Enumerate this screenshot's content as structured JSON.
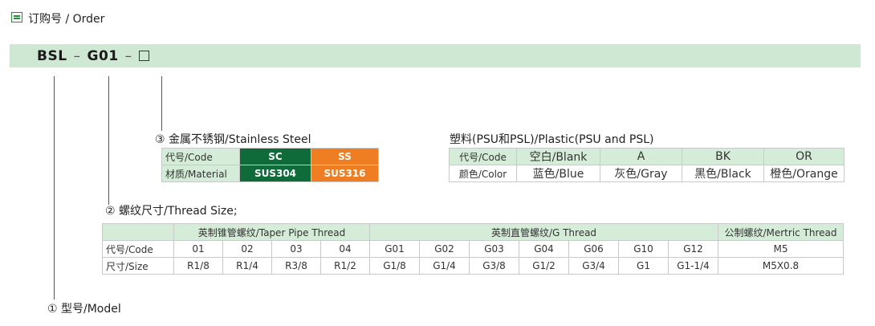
{
  "header": {
    "title": "订购号 / Order"
  },
  "code": {
    "part1": "BSL",
    "sep": "–",
    "part2": "G01"
  },
  "labels": {
    "material": "③ 金属不锈钢/Stainless Steel",
    "plastic": "塑料(PSU和PSL)/Plastic(PSU and PSL)",
    "thread": "② 螺纹尺寸/Thread Size;",
    "model": "① 型号/Model"
  },
  "material_table": {
    "row1": [
      "代号/Code",
      "SC",
      "SS"
    ],
    "row2": [
      "材质/Material",
      "SUS304",
      "SUS316"
    ]
  },
  "plastic_table": {
    "row1": [
      "代号/Code",
      "空白/Blank",
      "A",
      "BK",
      "OR"
    ],
    "row2": [
      "颜色/Color",
      "蓝色/Blue",
      "灰色/Gray",
      "黑色/Black",
      "橙色/Orange"
    ]
  },
  "thread_table": {
    "groups": [
      "英制锥管螺纹/Taper Pipe Thread",
      "英制直管螺纹/G Thread",
      "公制螺纹/Mertric Thread"
    ],
    "row_code_label": "代号/Code",
    "row_size_label": "尺寸/Size",
    "codes": [
      "01",
      "02",
      "03",
      "04",
      "G01",
      "G02",
      "G03",
      "G04",
      "G06",
      "G10",
      "G12",
      "M5"
    ],
    "sizes": [
      "R1/8",
      "R1/4",
      "R3/8",
      "R1/2",
      "G1/8",
      "G1/4",
      "G3/8",
      "G1/2",
      "G3/4",
      "G1",
      "G1-1/4",
      "M5X0.8"
    ]
  }
}
